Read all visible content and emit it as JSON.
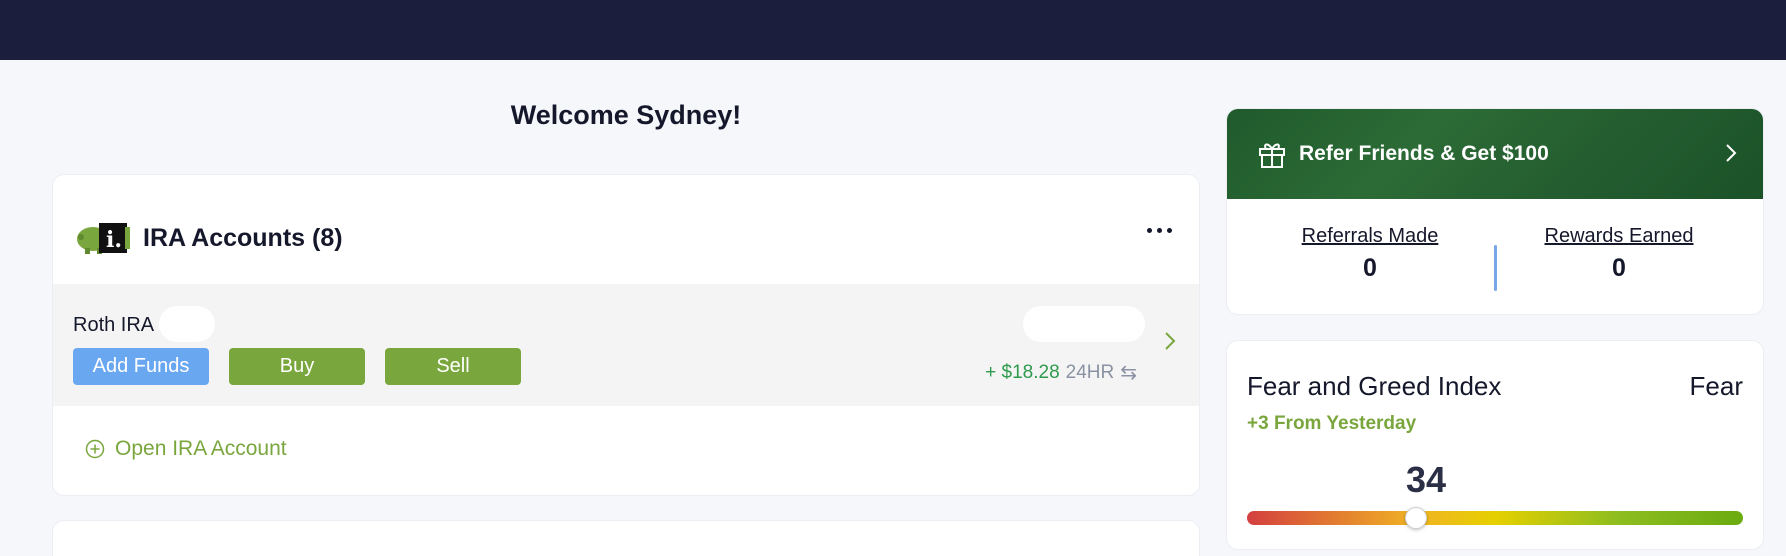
{
  "header": {
    "welcome": "Welcome Sydney!"
  },
  "ira_accounts": {
    "title": "IRA Accounts (8)",
    "logo_icon": "piggy-bank-ira-logo",
    "more_icon": "more-horizontal-icon",
    "accounts": [
      {
        "name": "Roth IRA",
        "change": "+ $18.28",
        "change_period": "24HR",
        "swap_icon": "⇆",
        "buttons": {
          "add_funds": "Add Funds",
          "buy": "Buy",
          "sell": "Sell"
        }
      }
    ],
    "open_account_label": "Open IRA Account"
  },
  "referral": {
    "banner_title": "Refer Friends & Get $100",
    "stats": [
      {
        "label": "Referrals Made",
        "value": "0"
      },
      {
        "label": "Rewards Earned",
        "value": "0"
      }
    ]
  },
  "fear_greed": {
    "title": "Fear and Greed Index",
    "sentiment": "Fear",
    "change": "+3 From Yesterday",
    "value": "34",
    "value_number": 34,
    "scale_max": 100
  },
  "colors": {
    "topbar": "#1b1f3d",
    "accent_green": "#7aa63e",
    "accent_blue": "#6aa7f1",
    "positive_green": "#2f9a4e",
    "banner_green": "#2c6b36"
  }
}
